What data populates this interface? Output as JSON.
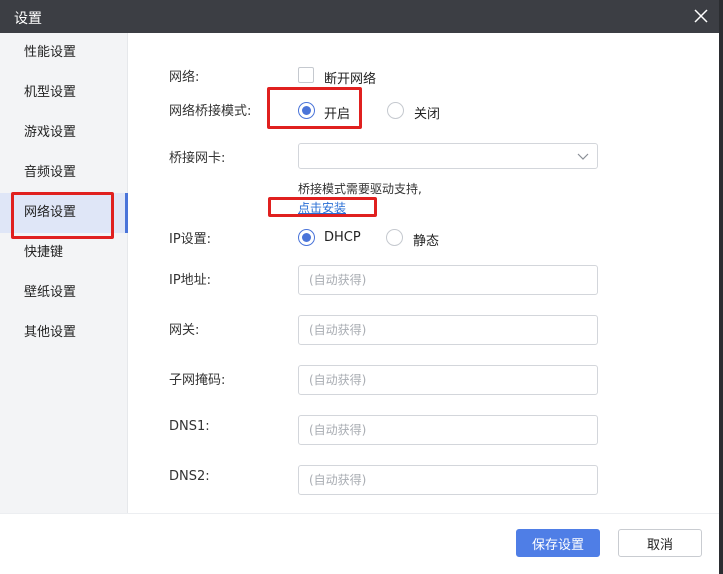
{
  "window": {
    "title": "设置"
  },
  "sidebar": {
    "items": [
      {
        "label": "性能设置",
        "active": false
      },
      {
        "label": "机型设置",
        "active": false
      },
      {
        "label": "游戏设置",
        "active": false
      },
      {
        "label": "音频设置",
        "active": false
      },
      {
        "label": "网络设置",
        "active": true
      },
      {
        "label": "快捷键",
        "active": false
      },
      {
        "label": "壁纸设置",
        "active": false
      },
      {
        "label": "其他设置",
        "active": false
      }
    ]
  },
  "network": {
    "network_label": "网络:",
    "disconnect_label": "断开网络",
    "disconnect_checked": false,
    "bridge_mode_label": "网络桥接模式:",
    "bridge_on_label": "开启",
    "bridge_off_label": "关闭",
    "bridge_selected": "开启",
    "bridge_nic_label": "桥接网卡:",
    "bridge_nic_value": "",
    "driver_hint": "桥接模式需要驱动支持,",
    "install_link": "点击安装",
    "ip_setting_label": "IP设置:",
    "dhcp_label": "DHCP",
    "static_label": "静态",
    "ip_selected": "DHCP",
    "ip_address_label": "IP地址:",
    "gateway_label": "网关:",
    "subnet_label": "子网掩码:",
    "dns1_label": "DNS1:",
    "dns2_label": "DNS2:",
    "auto_placeholder": "(自动获得)"
  },
  "footer": {
    "save_label": "保存设置",
    "cancel_label": "取消"
  },
  "colors": {
    "accent": "#4f7ee6",
    "highlight_box": "#e0201f",
    "sidebar_active": "#dfe6f7"
  }
}
